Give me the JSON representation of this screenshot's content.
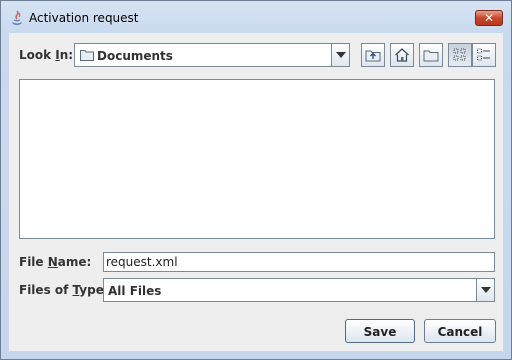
{
  "window": {
    "title": "Activation request",
    "close_symbol": "✕"
  },
  "look_in": {
    "label_prefix": "Look ",
    "label_mnemonic": "I",
    "label_suffix": "n:",
    "value": "Documents",
    "icon": "folder-icon"
  },
  "toolbar": {
    "buttons": [
      "up-folder-icon",
      "home-icon",
      "new-folder-icon",
      "list-view-icon",
      "details-view-icon"
    ]
  },
  "file_name": {
    "label_prefix": "File ",
    "label_mnemonic": "N",
    "label_suffix": "ame:",
    "value": "request.xml"
  },
  "file_type": {
    "label_prefix": "Files of ",
    "label_mnemonic": "T",
    "label_suffix": "ype:",
    "value": "All Files"
  },
  "actions": {
    "save_label": "Save",
    "cancel_label": "Cancel"
  },
  "colors": {
    "title_gradient_top": "#d6e3f3",
    "content_bg": "#eeeeee",
    "close_red": "#c9462d"
  }
}
